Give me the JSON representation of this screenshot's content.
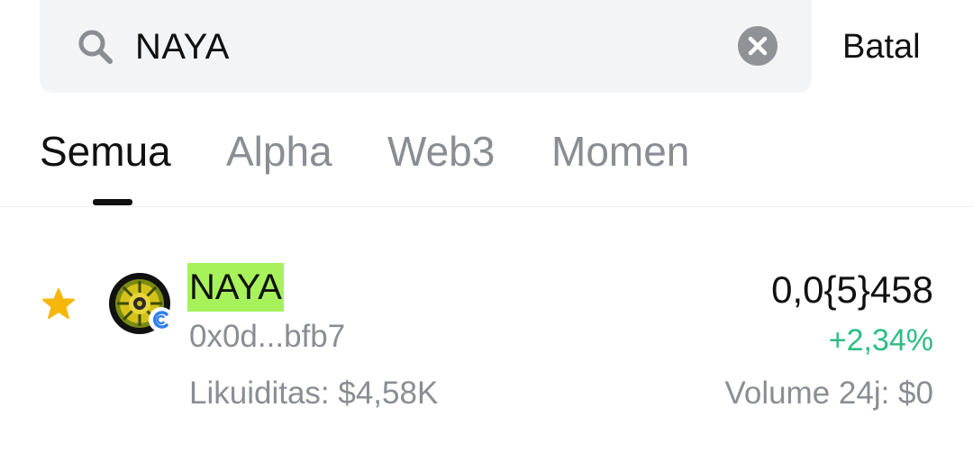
{
  "search": {
    "query": "NAYA",
    "cancel_label": "Batal"
  },
  "tabs": [
    {
      "label": "Semua",
      "active": true
    },
    {
      "label": "Alpha",
      "active": false
    },
    {
      "label": "Web3",
      "active": false
    },
    {
      "label": "Momen",
      "active": false
    }
  ],
  "results": [
    {
      "favorite": true,
      "name": "NAYA",
      "address": "0x0d...bfb7",
      "liquidity": "Likuiditas: $4,58K",
      "price": "0,0{5}458",
      "change": "+2,34%",
      "volume": "Volume 24j: $0"
    }
  ],
  "colors": {
    "search_bg": "#f3f4f6",
    "highlight": "#a7f25a",
    "positive": "#2ebd85",
    "star": "#f5b70a",
    "muted_text": "#8a8d93"
  },
  "icons": {
    "search": "search-icon",
    "clear": "clear-icon",
    "favorite": "star-icon",
    "chain": "chain-badge-icon"
  }
}
